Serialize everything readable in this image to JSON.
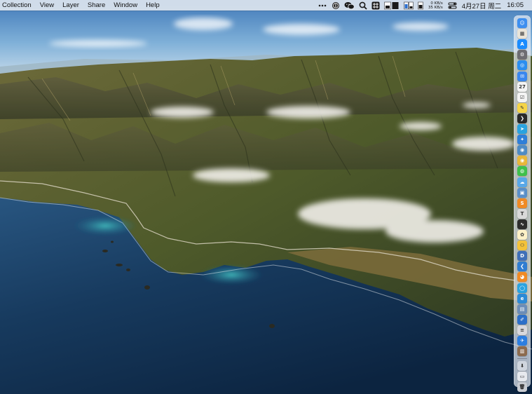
{
  "menubar": {
    "menus": [
      "Collection",
      "View",
      "Layer",
      "Share",
      "Window",
      "Help"
    ],
    "network": {
      "up": "0 KB/s",
      "down": "35 KB/s"
    },
    "date": "4月27日 周二",
    "time": "16:05",
    "status_icons": [
      "more-icon",
      "onepassword-icon",
      "wechat-icon",
      "search-icon",
      "grid-icon",
      "cpu-meter-icon",
      "memory-meter-icon",
      "disk-meter-icon",
      "netspeed-icon",
      "control-center-icon",
      "siri-icon"
    ]
  },
  "dock": {
    "items": [
      {
        "name": "finder-icon",
        "color": "#3d8ff0",
        "glyph": "☺"
      },
      {
        "name": "launchpad-icon",
        "color": "#e9e4d8",
        "glyph": "▦"
      },
      {
        "name": "app-store-icon",
        "color": "#1a8cff",
        "glyph": "A"
      },
      {
        "name": "system-preferences-icon",
        "color": "#6d6d72",
        "glyph": "⚙"
      },
      {
        "name": "safari-icon",
        "color": "#2b8ef0",
        "glyph": "◎"
      },
      {
        "name": "mail-icon",
        "color": "#3a87ee",
        "glyph": "✉"
      },
      {
        "name": "calendar-icon",
        "color": "#f4f4f4",
        "glyph": "27"
      },
      {
        "name": "reminders-icon",
        "color": "#f4f4f4",
        "glyph": "☑"
      },
      {
        "name": "notes-icon",
        "color": "#f5d447",
        "glyph": "✎"
      },
      {
        "name": "terminal-icon",
        "color": "#2a2a2a",
        "glyph": "❯"
      },
      {
        "name": "telegram-icon",
        "color": "#2aa3e0",
        "glyph": "➤"
      },
      {
        "name": "xcode-icon",
        "color": "#2f7fd8",
        "glyph": "✦"
      },
      {
        "name": "network-icon",
        "color": "#4e8bc4",
        "glyph": "◉"
      },
      {
        "name": "chrome-icon",
        "color": "#e8b73a",
        "glyph": "◉"
      },
      {
        "name": "wechat-app-icon",
        "color": "#3ec04b",
        "glyph": "◍"
      },
      {
        "name": "weather-icon",
        "color": "#58a8e8",
        "glyph": "☁"
      },
      {
        "name": "preview-icon",
        "color": "#5a8fc8",
        "glyph": "▣"
      },
      {
        "name": "sublime-text-icon",
        "color": "#f08a24",
        "glyph": "S"
      },
      {
        "name": "textedit-icon",
        "color": "#d9d9d9",
        "glyph": "T"
      },
      {
        "name": "activity-monitor-icon",
        "color": "#2d2d2d",
        "glyph": "∿"
      },
      {
        "name": "photos-icon",
        "color": "#fdf0c6",
        "glyph": "✿"
      },
      {
        "name": "cyberduck-icon",
        "color": "#f3c23a",
        "glyph": "⚇"
      },
      {
        "name": "vpn-icon",
        "color": "#3f6fb8",
        "glyph": "D"
      },
      {
        "name": "vscode-icon",
        "color": "#2f7dd1",
        "glyph": "❮"
      },
      {
        "name": "firefox-icon",
        "color": "#f08a24",
        "glyph": "◕"
      },
      {
        "name": "skype-icon",
        "color": "#2aa3e0",
        "glyph": "◯"
      },
      {
        "name": "edge-icon",
        "color": "#2c8ad6",
        "glyph": "e"
      },
      {
        "name": "screenshot-icon",
        "color": "#6b8db8",
        "glyph": "▤"
      },
      {
        "name": "script-editor-icon",
        "color": "#2c6fc8",
        "glyph": "✐"
      },
      {
        "name": "menu-app-icon",
        "color": "#d8d8dc",
        "glyph": "≡"
      },
      {
        "name": "installer-icon",
        "color": "#2c7ee0",
        "glyph": "✈"
      },
      {
        "name": "archive-icon",
        "color": "#8c6b4e",
        "glyph": "▥"
      },
      {
        "name": "downloads-folder-icon",
        "color": "#cfd5de",
        "glyph": "⬇"
      },
      {
        "name": "window-icon",
        "color": "#e6e9ee",
        "glyph": "▭"
      },
      {
        "name": "trash-icon",
        "color": "#c8ccd2",
        "glyph": "🗑"
      }
    ]
  }
}
